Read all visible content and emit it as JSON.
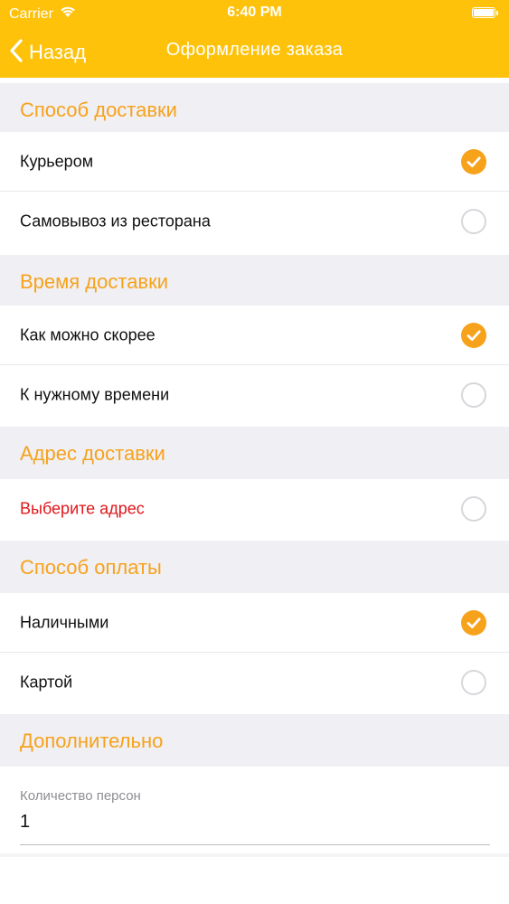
{
  "status_bar": {
    "carrier": "Carrier",
    "time": "6:40 PM",
    "battery_level": 1.0
  },
  "nav": {
    "back_label": "Назад",
    "title": "Оформление заказа"
  },
  "colors": {
    "accent": "#FEC20B",
    "section_text": "#F7A21B",
    "check": "#F7A21B",
    "warning": "#E0161B",
    "section_bg": "#EFEFF4"
  },
  "sections": [
    {
      "title": "Способ доставки",
      "options": [
        {
          "label": "Курьером",
          "selected": true
        },
        {
          "label": "Самовывоз из ресторана",
          "selected": false
        }
      ]
    },
    {
      "title": "Время доставки",
      "options": [
        {
          "label": "Как можно скорее",
          "selected": true
        },
        {
          "label": "К нужному времени",
          "selected": false
        }
      ]
    },
    {
      "title": "Адрес доставки",
      "options": [
        {
          "label": "Выберите адрес",
          "selected": false,
          "warning": true
        }
      ]
    },
    {
      "title": "Способ оплаты",
      "options": [
        {
          "label": "Наличными",
          "selected": true
        },
        {
          "label": "Картой",
          "selected": false
        }
      ]
    },
    {
      "title": "Дополнительно",
      "options": []
    }
  ],
  "extra": {
    "persons_caption": "Количество персон",
    "persons_value": "1"
  },
  "icons": {
    "back": "chevron-left-icon",
    "wifi": "wifi-icon",
    "battery": "battery-icon",
    "check": "checkmark-icon"
  }
}
